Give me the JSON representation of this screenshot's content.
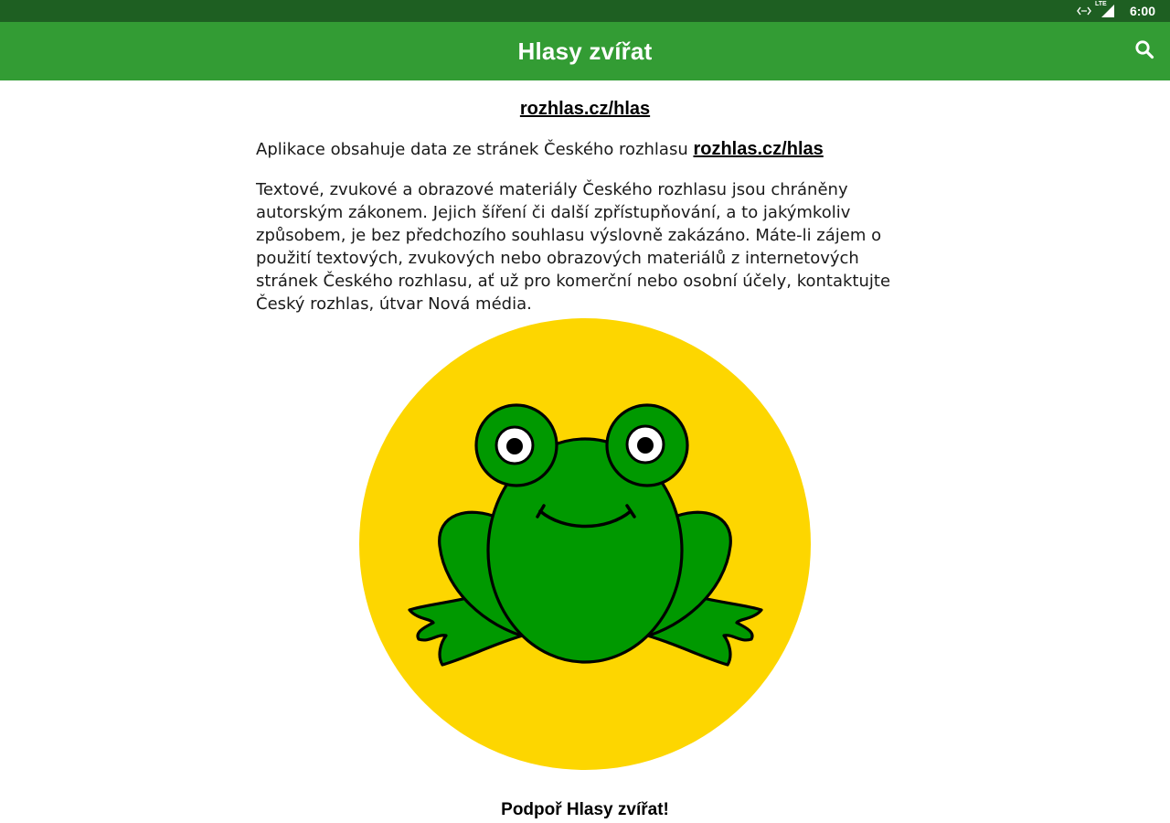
{
  "status_bar": {
    "time": "6:00",
    "network": "LTE",
    "icons": [
      "data-transfer-icon",
      "signal-icon"
    ]
  },
  "app_bar": {
    "title": "Hlasy zvířat",
    "search_icon": "search-icon"
  },
  "content": {
    "source_link": "rozhlas.cz/hlas",
    "para1_text": "Aplikace obsahuje data ze stránek Českého rozhlasu ",
    "para1_link": "rozhlas.cz/hlas",
    "para2_text": "Textové, zvukové a obrazové materiály Českého rozhlasu jsou chráněny autorským zákonem. Jejich šíření či další zpřístupňování, a to jakýmkoliv způsobem, je bez předchozího souhlasu výslovně zakázáno. Máte-li zájem o použití textových, zvukových nebo obrazových materiálů z internetových stránek Českého rozhlasu, ať už pro komerční nebo osobní účely, kontaktujte Český rozhlas, útvar Nová média.",
    "illustration": "frog-logo",
    "support_text": "Podpoř Hlasy zvířat!"
  },
  "colors": {
    "status_bar": "#1e5f22",
    "app_bar": "#339c34",
    "logo_circle": "#fdd600",
    "frog_green": "#009900"
  }
}
